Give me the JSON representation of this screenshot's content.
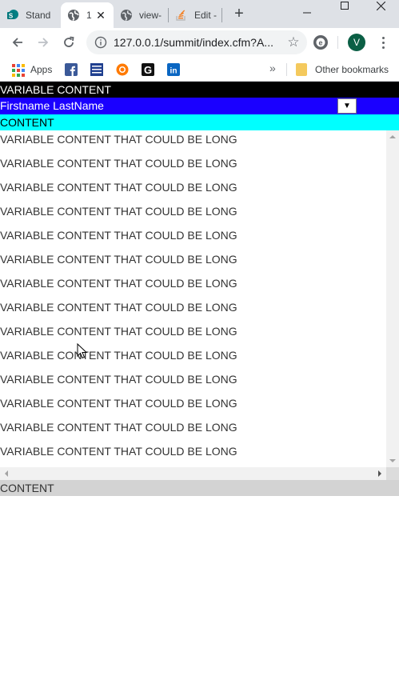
{
  "browser": {
    "tabs": [
      {
        "title": "Stand",
        "icon": "sharepoint-icon"
      },
      {
        "title": "1",
        "icon": "globe-icon",
        "active": true
      },
      {
        "title": "view-",
        "icon": "globe-icon"
      },
      {
        "title": "Edit -",
        "icon": "stackoverflow-icon"
      }
    ],
    "new_tab": "+",
    "url": "127.0.0.1/summit/index.cfm?A...",
    "profile_initial": "V",
    "bookmarks": {
      "apps_label": "Apps",
      "icons": [
        "facebook-icon",
        "weather-channel-icon",
        "orange-sun-icon",
        "g-icon",
        "linkedin-icon"
      ],
      "overflow": "»",
      "other_label": "Other bookmarks"
    }
  },
  "page": {
    "header_black": "VARIABLE CONTENT",
    "header_blue_user": "Firstname LastName",
    "select_arrow": "▼",
    "header_cyan": "CONTENT",
    "rows": [
      "VARIABLE CONTENT THAT COULD BE LONG",
      "VARIABLE CONTENT THAT COULD BE LONG",
      "VARIABLE CONTENT THAT COULD BE LONG",
      "VARIABLE CONTENT THAT COULD BE LONG",
      "VARIABLE CONTENT THAT COULD BE LONG",
      "VARIABLE CONTENT THAT COULD BE LONG",
      "VARIABLE CONTENT THAT COULD BE LONG",
      "VARIABLE CONTENT THAT COULD BE LONG",
      "VARIABLE CONTENT THAT COULD BE LONG",
      "VARIABLE CONTENT THAT COULD BE LONG",
      "VARIABLE CONTENT THAT COULD BE LONG",
      "VARIABLE CONTENT THAT COULD BE LONG",
      "VARIABLE CONTENT THAT COULD BE LONG",
      "VARIABLE CONTENT THAT COULD BE LONG"
    ],
    "footer": "CONTENT"
  },
  "colors": {
    "header_black": "#000000",
    "header_blue": "#1a00ff",
    "header_cyan": "#00ffff",
    "footer": "#d3d3d3"
  }
}
